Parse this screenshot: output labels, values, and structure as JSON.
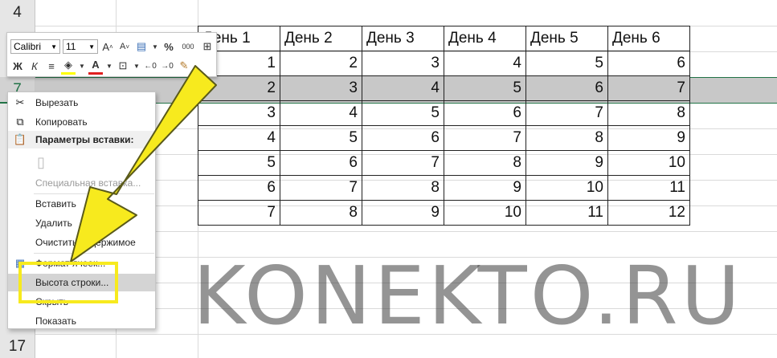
{
  "row_headers": {
    "top": "4",
    "selected": "7",
    "bottom": "17"
  },
  "table": {
    "headers": [
      "День 1",
      "День 2",
      "День 3",
      "День 4",
      "День 5",
      "День 6"
    ],
    "rows": [
      [
        "1",
        "2",
        "3",
        "4",
        "5",
        "6"
      ],
      [
        "2",
        "3",
        "4",
        "5",
        "6",
        "7"
      ],
      [
        "3",
        "4",
        "5",
        "6",
        "7",
        "8"
      ],
      [
        "4",
        "5",
        "6",
        "7",
        "8",
        "9"
      ],
      [
        "5",
        "6",
        "7",
        "8",
        "9",
        "10"
      ],
      [
        "6",
        "7",
        "8",
        "9",
        "10",
        "11"
      ],
      [
        "7",
        "8",
        "9",
        "10",
        "11",
        "12"
      ]
    ]
  },
  "mini_toolbar": {
    "font_name": "Calibri",
    "font_size": "11",
    "grow_font": "A",
    "shrink_font": "A",
    "percent": "%",
    "thousands": "000",
    "bold": "Ж",
    "italic": "К",
    "font_color_letter": "A"
  },
  "context_menu": {
    "cut": "Вырезать",
    "copy": "Копировать",
    "paste_options": "Параметры вставки:",
    "paste_special": "Специальная вставка...",
    "insert": "Вставить",
    "delete": "Удалить",
    "clear_contents": "Очистить содержимое",
    "format_cells": "Формат ячеек...",
    "row_height": "Высота строки...",
    "hide": "Скрыть",
    "unhide": "Показать"
  },
  "watermark": "KONEKTO.RU",
  "colors": {
    "excel_green": "#217346",
    "highlight_yellow": "#f7ea1e",
    "selected_row": "#c8c8c8"
  }
}
